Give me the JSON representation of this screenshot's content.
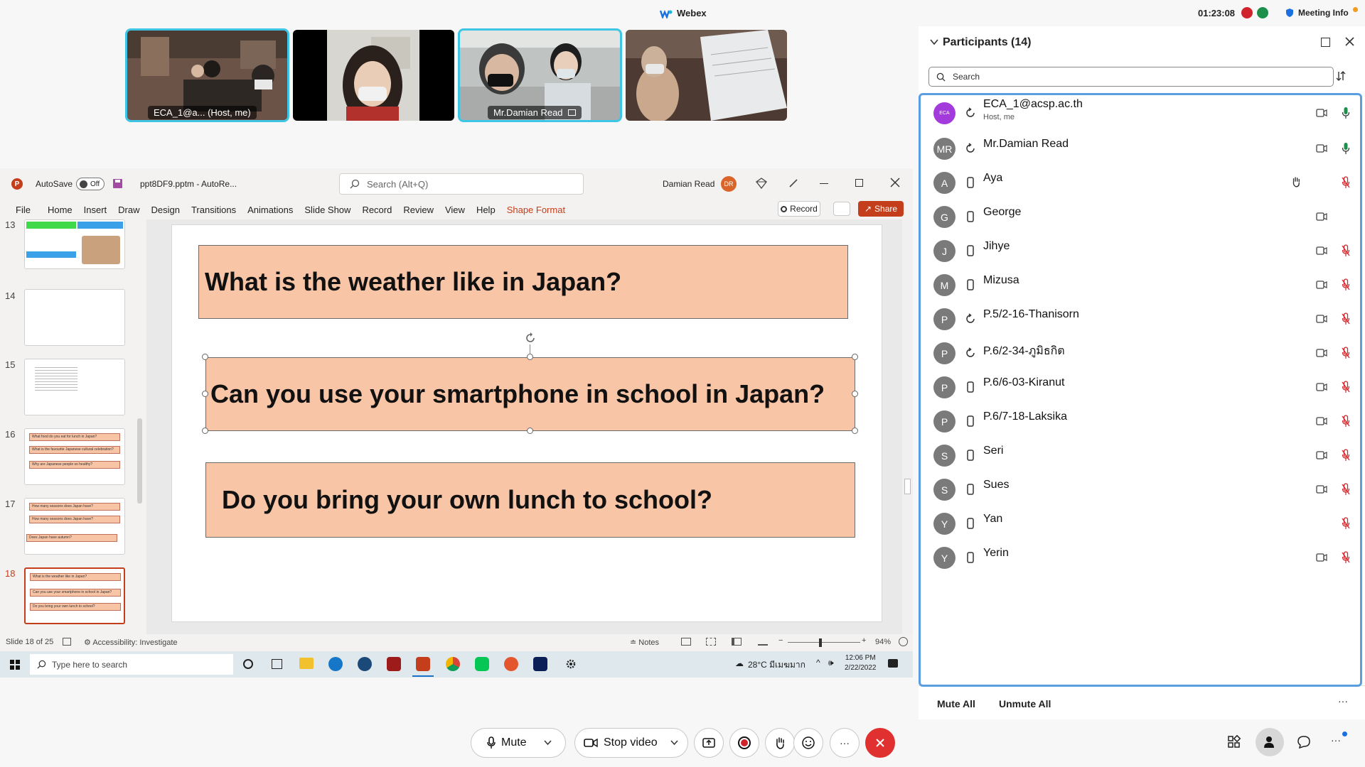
{
  "topbar": {
    "app_title": "Webex",
    "timer": "01:23:08",
    "meeting_info": "Meeting Info"
  },
  "videos": [
    {
      "name": "ECA_1@a... (Host, me)",
      "active": true
    },
    {
      "name": "",
      "active": false
    },
    {
      "name": "Mr.Damian Read",
      "active": true
    },
    {
      "name": "",
      "active": false
    }
  ],
  "ppt": {
    "autosave_label": "AutoSave",
    "autosave_state": "Off",
    "file_name": "ppt8DF9.pptm - AutoRe...",
    "search_placeholder": "Search (Alt+Q)",
    "user_name": "Damian Read",
    "user_initials": "DR",
    "menu": [
      "File",
      "Home",
      "Insert",
      "Draw",
      "Design",
      "Transitions",
      "Animations",
      "Slide Show",
      "Record",
      "Review",
      "View",
      "Help",
      "Shape Format"
    ],
    "record_button": "Record",
    "share_button": "Share",
    "thumbnails": [
      {
        "num": "13",
        "boxes": []
      },
      {
        "num": "14",
        "boxes": []
      },
      {
        "num": "15",
        "boxes": []
      },
      {
        "num": "16",
        "boxes": [
          "What food do you eat for lunch in Japan?",
          "What is the favourite Japanese cultural celebration?",
          "Why are Japanese people so healthy?"
        ]
      },
      {
        "num": "17",
        "boxes": [
          "How many seasons does Japan have?",
          "How many seasons does Japan have?",
          "Does Japan have autumn?"
        ]
      },
      {
        "num": "18",
        "boxes": [
          "What is the weather like in Japan?",
          "Can you use your smartphone in school in Japan?",
          "Do you bring your own lunch to school?"
        ]
      }
    ],
    "slide": {
      "box1": "What is the weather like in Japan?",
      "box2": "Can you use your smartphone in school in Japan?",
      "box3": "Do you bring your own lunch to school?"
    },
    "status": {
      "slide_count": "Slide 18 of 25",
      "accessibility": "Accessibility: Investigate",
      "notes": "Notes",
      "zoom": "94%"
    },
    "taskbar": {
      "search_placeholder": "Type here to search",
      "weather": "28°C มีเมฆมาก",
      "time": "12:06 PM",
      "date": "2/22/2022"
    }
  },
  "participants": {
    "title": "Participants (14)",
    "search_placeholder": "Search",
    "list": [
      {
        "name": "ECA_1@acsp.ac.th",
        "sub": "Host, me",
        "initials": "ECA",
        "avatar_color": "#a33bdc",
        "device": "sync",
        "cam": true,
        "mic": "on"
      },
      {
        "name": "Mr.Damian Read",
        "sub": "",
        "initials": "MR",
        "avatar_color": "#7a7a7a",
        "device": "sync",
        "cam": true,
        "mic": "on"
      },
      {
        "name": "Aya",
        "sub": "",
        "initials": "A",
        "avatar_color": "#7a7a7a",
        "device": "phone",
        "cam": false,
        "mic": "muted",
        "hand": true
      },
      {
        "name": "George",
        "sub": "",
        "initials": "G",
        "avatar_color": "#7a7a7a",
        "device": "phone",
        "cam": true,
        "mic": "none"
      },
      {
        "name": "Jihye",
        "sub": "",
        "initials": "J",
        "avatar_color": "#7a7a7a",
        "device": "phone",
        "cam": true,
        "mic": "muted"
      },
      {
        "name": "Mizusa",
        "sub": "",
        "initials": "M",
        "avatar_color": "#7a7a7a",
        "device": "phone",
        "cam": true,
        "mic": "muted"
      },
      {
        "name": "P.5/2-16-Thanisorn",
        "sub": "",
        "initials": "P",
        "avatar_color": "#7a7a7a",
        "device": "sync",
        "cam": true,
        "mic": "muted"
      },
      {
        "name": "P.6/2-34-ภูมิธกิต",
        "sub": "",
        "initials": "P",
        "avatar_color": "#7a7a7a",
        "device": "sync",
        "cam": true,
        "mic": "muted"
      },
      {
        "name": "P.6/6-03-Kiranut",
        "sub": "",
        "initials": "P",
        "avatar_color": "#7a7a7a",
        "device": "phone",
        "cam": true,
        "mic": "muted"
      },
      {
        "name": "P.6/7-18-Laksika",
        "sub": "",
        "initials": "P",
        "avatar_color": "#7a7a7a",
        "device": "phone",
        "cam": true,
        "mic": "muted"
      },
      {
        "name": "Seri",
        "sub": "",
        "initials": "S",
        "avatar_color": "#7a7a7a",
        "device": "phone",
        "cam": true,
        "mic": "muted"
      },
      {
        "name": "Sues",
        "sub": "",
        "initials": "S",
        "avatar_color": "#7a7a7a",
        "device": "phone",
        "cam": true,
        "mic": "muted"
      },
      {
        "name": "Yan",
        "sub": "",
        "initials": "Y",
        "avatar_color": "#7a7a7a",
        "device": "phone",
        "cam": false,
        "mic": "muted"
      },
      {
        "name": "Yerin",
        "sub": "",
        "initials": "Y",
        "avatar_color": "#7a7a7a",
        "device": "phone",
        "cam": true,
        "mic": "muted"
      }
    ],
    "mute_all": "Mute All",
    "unmute_all": "Unmute All",
    "more": "···"
  },
  "controls": {
    "mute": "Mute",
    "stop_video": "Stop video",
    "more": "···"
  },
  "colors": {
    "accent_blue": "#3ec5e6",
    "leave_red": "#e0302f",
    "slide_box": "#f8c5a7",
    "ppt_red": "#c43e1c"
  }
}
